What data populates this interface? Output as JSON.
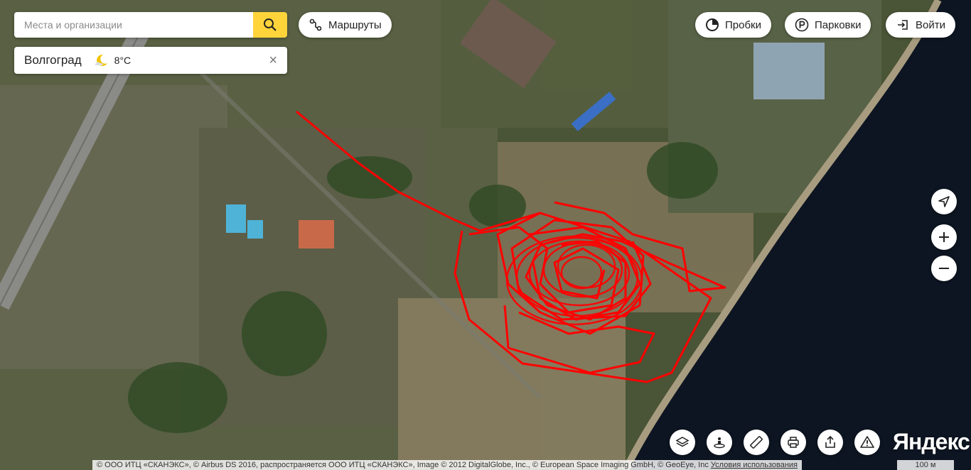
{
  "search": {
    "placeholder": "Места и организации",
    "button_icon": "search-icon"
  },
  "city": {
    "name": "Волгоград",
    "weather_icon": "moon-cloud-icon",
    "temperature": "8°C",
    "close_symbol": "×"
  },
  "header": {
    "routes_label": "Маршруты",
    "traffic_label": "Пробки",
    "parking_label": "Парковки",
    "login_label": "Войти"
  },
  "controls": {
    "locate_icon": "location-arrow-icon",
    "zoom_in_icon": "plus-icon",
    "zoom_out_icon": "minus-icon"
  },
  "toolbar": [
    "layers-icon",
    "panorama-icon",
    "ruler-icon",
    "print-icon",
    "share-icon",
    "report-icon"
  ],
  "logo": "Яндекс",
  "footer": {
    "copyright": "© ООО ИТЦ «СКАНЭКС», © Airbus DS 2016, распространяется ООО ИТЦ «СКАНЭКС», Image © 2012 DigitalGlobe, Inc., © European Space Imaging GmbH, © GeoEye, Inc",
    "terms": "Условия использования",
    "scale": "100 м"
  },
  "colors": {
    "track": "#ff0000",
    "search_button": "#ffd43b",
    "river": "#0d1522"
  }
}
